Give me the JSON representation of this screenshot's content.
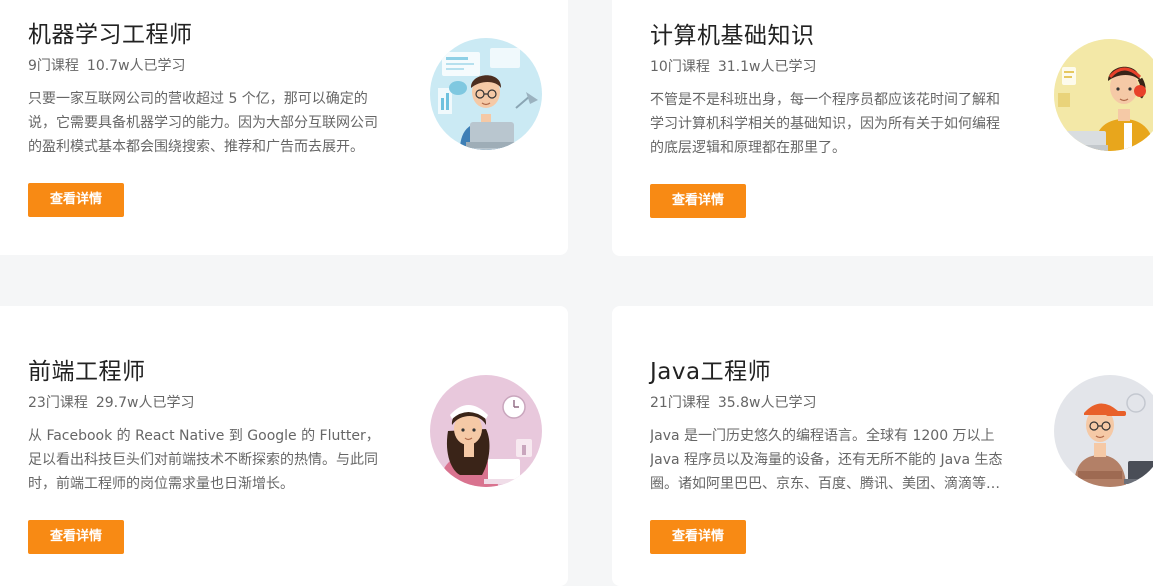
{
  "courses": [
    {
      "title": "机器学习工程师",
      "count": "9门课程",
      "learners": "10.7w人已学习",
      "description": "只要一家互联网公司的营收超过 5 个亿，那可以确定的说，它需要具备机器学习的能力。因为大部分互联网公司的盈利模式基本都会围绕搜索、推荐和广告而去展开。",
      "button": "查看详情",
      "illustration": "ml-engineer-illustration"
    },
    {
      "title": "计算机基础知识",
      "count": "10门课程",
      "learners": "31.1w人已学习",
      "description": "不管是不是科班出身，每一个程序员都应该花时间了解和学习计算机科学相关的基础知识，因为所有关于如何编程的底层逻辑和原理都在那里了。",
      "button": "查看详情",
      "illustration": "cs-fundamentals-illustration"
    },
    {
      "title": "前端工程师",
      "count": "23门课程",
      "learners": "29.7w人已学习",
      "description": "从 Facebook 的 React Native 到 Google 的 Flutter，足以看出科技巨头们对前端技术不断探索的热情。与此同时，前端工程师的岗位需求量也日渐增长。",
      "button": "查看详情",
      "illustration": "frontend-engineer-illustration"
    },
    {
      "title": "Java工程师",
      "count": "21门课程",
      "learners": "35.8w人已学习",
      "description": "Java 是一门历史悠久的编程语言。全球有 1200 万以上 Java 程序员以及海量的设备，还有无所不能的 Java 生态圈。诸如阿里巴巴、京东、百度、腾讯、美团、滴滴等公司都在使用。",
      "button": "查看详情",
      "illustration": "java-engineer-illustration"
    }
  ],
  "colors": {
    "page_background": "#f5f6f7",
    "card_background": "#ffffff",
    "button_accent": "#f88a14",
    "title_text": "#222222",
    "body_text": "#666666"
  }
}
